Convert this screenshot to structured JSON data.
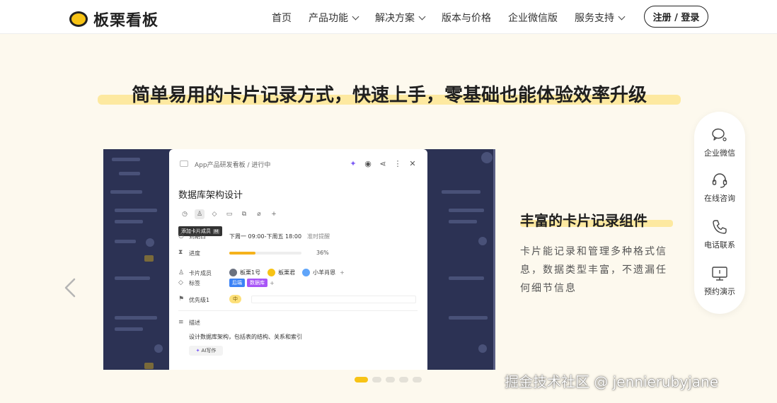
{
  "header": {
    "logo_text": "板栗看板",
    "nav": [
      {
        "label": "首页",
        "dropdown": false
      },
      {
        "label": "产品功能",
        "dropdown": true
      },
      {
        "label": "解决方案",
        "dropdown": true
      },
      {
        "label": "版本与价格",
        "dropdown": false
      },
      {
        "label": "企业微信版",
        "dropdown": false
      },
      {
        "label": "服务支持",
        "dropdown": true
      }
    ],
    "login_label": "注册 / 登录"
  },
  "hero": {
    "headline": "简单易用的卡片记录方式，快速上手，零基础也能体验效率升级"
  },
  "card": {
    "breadcrumb": "App产品研发看板 / 进行中",
    "title": "数据库架构设计",
    "tooltip": "添加卡片成员",
    "tooltip_key": "M",
    "date_label": "到期日",
    "date_value": "下周一 09:00-下周五 18:00",
    "reminder": "准时提醒",
    "progress_label": "进度",
    "progress_text": "36%",
    "progress_fraction": 0.36,
    "members_label": "卡片成员",
    "members": [
      {
        "name": "板栗1号",
        "color": "#6b7280"
      },
      {
        "name": "板栗君",
        "color": "#f7c315"
      },
      {
        "name": "小羊肖恩",
        "color": "#60a5fa"
      }
    ],
    "add_symbol": "+",
    "tags_label": "标签",
    "tags": [
      {
        "name": "后端",
        "color": "#3b82f6"
      },
      {
        "name": "数据库",
        "color": "#a855f7"
      }
    ],
    "priority_label": "优先级1",
    "priority_value": "中",
    "desc_label": "描述",
    "desc_text": "设计数据库架构，包括表的结构、关系和索引",
    "ai_label": "AI写作"
  },
  "feature": {
    "title": "丰富的卡片记录组件",
    "description": "卡片能记录和管理多种格式信息，数据类型丰富，不遗漏任何细节信息"
  },
  "carousel": {
    "dots": 5,
    "active_index": 0
  },
  "float_bar": {
    "items": [
      {
        "label": "企业微信",
        "icon": "wechat-work-icon"
      },
      {
        "label": "在线咨询",
        "icon": "headset-icon"
      },
      {
        "label": "电话联系",
        "icon": "phone-icon"
      },
      {
        "label": "预约演示",
        "icon": "monitor-icon"
      }
    ]
  },
  "watermark": "掘金技术社区 @ jennierubyjane",
  "colors": {
    "accent": "#f7c315",
    "highlight": "#fde9a0",
    "page_bg": "#fdf9ee",
    "dark_panel": "#2a3050"
  }
}
